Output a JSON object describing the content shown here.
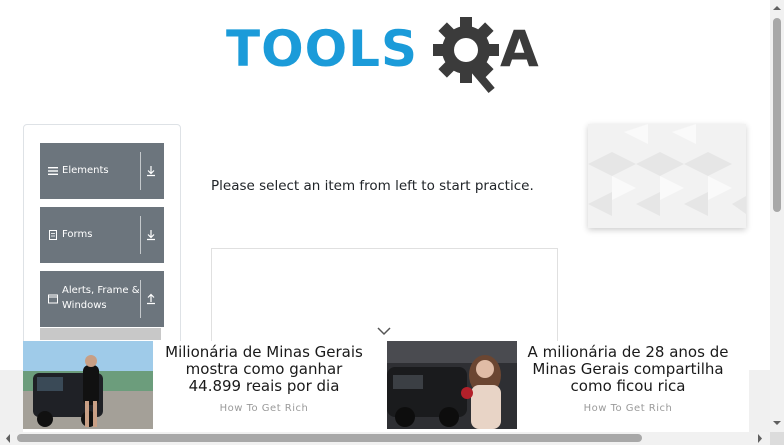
{
  "logo": {
    "text_left": "TOOLS",
    "text_right": "A",
    "colors": {
      "tools": "#1b9bd9",
      "qa": "#3b3b3b"
    }
  },
  "sidebar": {
    "groups": [
      {
        "label": "Elements",
        "icon": "list-icon",
        "arrow": "download-arrow-icon"
      },
      {
        "label": "Forms",
        "icon": "document-icon",
        "arrow": "download-arrow-icon"
      },
      {
        "label_line1": "Alerts, Frame &",
        "label_line2": "Windows",
        "icon": "window-icon",
        "arrow": "upload-arrow-icon"
      }
    ],
    "colors": {
      "group_bg": "#6c757d"
    }
  },
  "main": {
    "instruction": "Please select an item from left to start practice."
  },
  "ads": [
    {
      "title_line1": "Milionária de Minas Gerais",
      "title_line2": "mostra como ganhar",
      "title_line3": "44.899 reais por dia",
      "source": "How To Get Rich"
    },
    {
      "title_line1": "A milionária de 28 anos de",
      "title_line2": "Minas Gerais compartilha",
      "title_line3": "como ficou rica",
      "source": "How To Get Rich"
    }
  ]
}
